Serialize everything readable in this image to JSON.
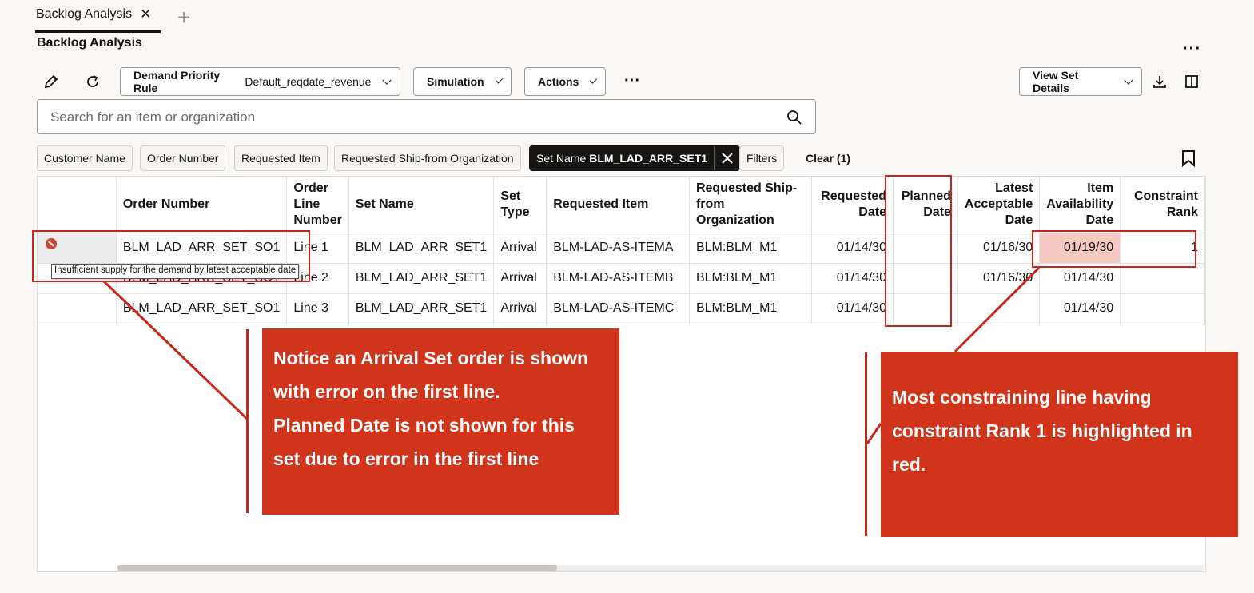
{
  "tabs": [
    {
      "label": "Backlog Analysis"
    }
  ],
  "page_title": "Backlog Analysis",
  "toolbar": {
    "demand_priority_label": "Demand Priority Rule",
    "demand_priority_value": "Default_reqdate_revenue",
    "simulation_label": "Simulation",
    "actions_label": "Actions",
    "view_set_details_label": "View Set Details"
  },
  "search": {
    "placeholder": "Search for an item or organization"
  },
  "filter_chips": [
    "Customer Name",
    "Order Number",
    "Requested Item",
    "Requested Ship-from Organization"
  ],
  "active_filter": {
    "label": "Set Name",
    "value": "BLM_LAD_ARR_SET1"
  },
  "filters_label": "Filters",
  "clear_label": "Clear (1)",
  "table": {
    "columns": [
      "Order Number",
      "Order Line Number",
      "Set Name",
      "Set Type",
      "Requested Item",
      "Requested Ship-from Organization",
      "Requested Date",
      "Planned Date",
      "Latest Acceptable Date",
      "Item Availability Date",
      "Constraint Rank"
    ],
    "rows": [
      {
        "order": "BLM_LAD_ARR_SET_SO1",
        "line": "Line 1",
        "set": "BLM_LAD_ARR_SET1",
        "type": "Arrival",
        "item": "BLM-LAD-AS-ITEMA",
        "org": "BLM:BLM_M1",
        "req_date": "01/14/30",
        "planned": "",
        "lad": "01/16/30",
        "avail": "01/19/30",
        "rank": "1",
        "error": true
      },
      {
        "order": "BLM_LAD_ARR_SET_SO1",
        "line": "Line 2",
        "set": "BLM_LAD_ARR_SET1",
        "type": "Arrival",
        "item": "BLM-LAD-AS-ITEMB",
        "org": "BLM:BLM_M1",
        "req_date": "01/14/30",
        "planned": "",
        "lad": "01/16/30",
        "avail": "01/14/30",
        "rank": "",
        "error": false
      },
      {
        "order": "BLM_LAD_ARR_SET_SO1",
        "line": "Line 3",
        "set": "BLM_LAD_ARR_SET1",
        "type": "Arrival",
        "item": "BLM-LAD-AS-ITEMC",
        "org": "BLM:BLM_M1",
        "req_date": "01/14/30",
        "planned": "",
        "lad": "",
        "avail": "01/14/30",
        "rank": "",
        "error": false
      }
    ],
    "highlight_color": "#f6c9c3"
  },
  "tooltip": "Insufficient supply for the demand by latest acceptable date",
  "callouts": {
    "left": [
      "Notice an Arrival Set order is shown",
      "with error on the first line.",
      "Planned Date is not shown for this",
      "set due to error in the first line"
    ],
    "right": [
      "Most constraining line having",
      "constraint Rank 1 is highlighted in",
      "red."
    ]
  },
  "colors": {
    "callout_bg": "#d0341a",
    "annotation_red": "#c7261a",
    "chip_active_bg": "#161513"
  }
}
